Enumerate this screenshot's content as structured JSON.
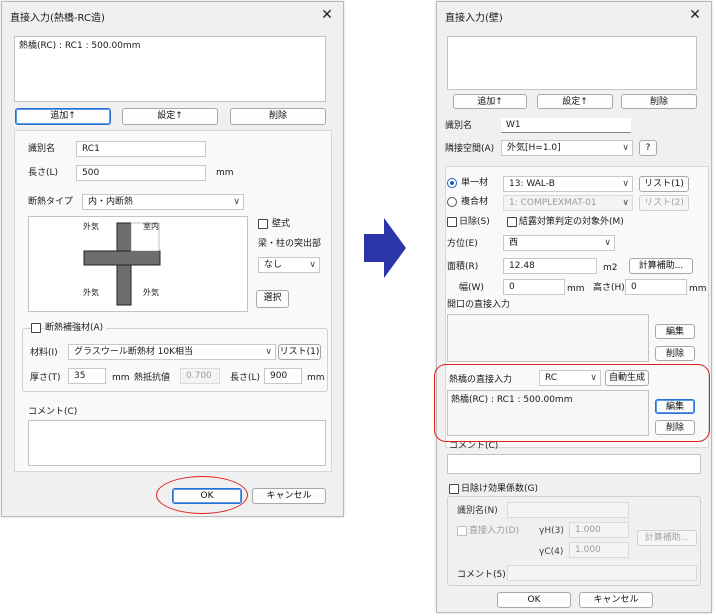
{
  "left_dialog": {
    "title": "直接入力(熱橋-RC造)",
    "list_entry": "熱橋(RC) : RC1 : 500.00mm",
    "add_button": "追加↑",
    "set_button": "設定↑",
    "delete_button": "削除",
    "id_label": "識別名",
    "id_value": "RC1",
    "length_label": "長さ(L)",
    "length_value": "500",
    "length_unit": "mm",
    "insulation_type_label": "断熱タイプ",
    "insulation_type_value": "内・内断熱",
    "outside_tl": "外気",
    "inside_tr": "室内",
    "outside_bl": "外気",
    "outside_br": "外気",
    "wall_type_label": "壁式",
    "beam_label": "梁・柱の突出部",
    "beam_value": "なし",
    "select_button": "選択",
    "reinforcement_label": "断熱補強材(A)",
    "material_label": "材料(I)",
    "material_value": "グラスウール断熱材 10K相当",
    "list_button": "リスト(1)",
    "thickness_label": "厚さ(T)",
    "thickness_value": "35",
    "thickness_unit": "mm",
    "resistance_label": "熱抵抗値",
    "resistance_value": "0.700",
    "length2_label": "長さ(L)",
    "length2_value": "900",
    "length2_unit": "mm",
    "comment_label": "コメント(C)",
    "ok_button": "OK",
    "cancel_button": "キャンセル"
  },
  "right_dialog": {
    "title": "直接入力(壁)",
    "add_button": "追加↑",
    "set_button": "設定↑",
    "delete_button": "削除",
    "id_label": "識別名",
    "id_value": "W1",
    "adjacent_label": "隣接空間(A)",
    "adjacent_value": "外気[H=1.0]",
    "help_button": "?",
    "single_label": "単一材",
    "single_value": "13: WAL-B",
    "list1_button": "リスト(1)",
    "composite_label": "複合材",
    "composite_value": "1: COMPLEXMAT-01",
    "list2_button": "リスト(2)",
    "shade_label": "日除(S)",
    "condensation_label": "結露対策判定の対象外(M)",
    "direction_label": "方位(E)",
    "direction_value": "西",
    "area_label": "面積(R)",
    "area_value": "12.48",
    "area_unit": "m2",
    "calc_button": "計算補助...",
    "width_label": "幅(W)",
    "width_value": "0",
    "width_unit": "mm",
    "height_label": "高さ(H)",
    "height_value": "0",
    "height_unit": "mm",
    "opening_label": "開口の直接入力",
    "opening_edit_button": "編集",
    "opening_delete_button": "削除",
    "thermal_bridge_label": "熱橋の直接入力",
    "thermal_bridge_type": "RC",
    "auto_generate_button": "自動生成",
    "thermal_bridge_entry": "熱橋(RC) : RC1 : 500.00mm",
    "tb_edit_button": "編集",
    "tb_delete_button": "削除",
    "comment_label": "コメント(C)",
    "shade_effect_label": "日除け効果係数(G)",
    "shade_id_label": "識別名(N)",
    "direct_input_label": "直接入力(D)",
    "yh_label": "γH(3)",
    "yh_value": "1.000",
    "yc_label": "γC(4)",
    "yc_value": "1.000",
    "shade_calc_button": "計算補助...",
    "shade_comment_label": "コメント(5)",
    "ok_button": "OK",
    "cancel_button": "キャンセル"
  },
  "colors": {
    "accent": "#2c6fd1",
    "annotation": "#e02020",
    "arrow": "#2b35a8"
  }
}
